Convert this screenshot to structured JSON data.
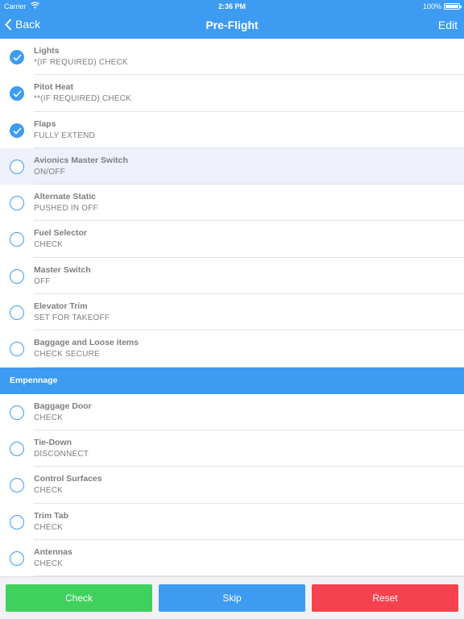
{
  "status": {
    "carrier": "Carrier",
    "time": "2:36 PM",
    "battery": "100%"
  },
  "nav": {
    "back": "Back",
    "title": "Pre-Flight",
    "edit": "Edit"
  },
  "colors": {
    "accent": "#3d9bf2",
    "check": "#3ed15d",
    "reset": "#f6424f",
    "selected_row": "#eef0fb"
  },
  "items": [
    {
      "title": "Lights",
      "action": "*(IF REQUIRED) CHECK",
      "checked": true
    },
    {
      "title": "Pitot Heat",
      "action": "**(IF REQUIRED) CHECK",
      "checked": true
    },
    {
      "title": "Flaps",
      "action": "FULLY EXTEND",
      "checked": true
    },
    {
      "title": "Avionics Master Switch",
      "action": "ON/OFF",
      "checked": false,
      "selected": true
    },
    {
      "title": "Alternate Static",
      "action": "PUSHED IN OFF",
      "checked": false
    },
    {
      "title": "Fuel Selector",
      "action": "CHECK",
      "checked": false
    },
    {
      "title": "Master Switch",
      "action": "OFF",
      "checked": false
    },
    {
      "title": "Elevator Trim",
      "action": "SET FOR TAKEOFF",
      "checked": false
    },
    {
      "title": "Baggage and Loose items",
      "action": "CHECK SECURE",
      "checked": false
    }
  ],
  "section": {
    "title": "Empennage"
  },
  "section_items": [
    {
      "title": "Baggage Door",
      "action": "CHECK",
      "checked": false
    },
    {
      "title": "Tie-Down",
      "action": "DISCONNECT",
      "checked": false
    },
    {
      "title": "Control Surfaces",
      "action": "CHECK",
      "checked": false
    },
    {
      "title": "Trim Tab",
      "action": "CHECK",
      "checked": false
    },
    {
      "title": "Antennas",
      "action": "CHECK",
      "checked": false
    }
  ],
  "buttons": {
    "check": "Check",
    "skip": "Skip",
    "reset": "Reset"
  }
}
